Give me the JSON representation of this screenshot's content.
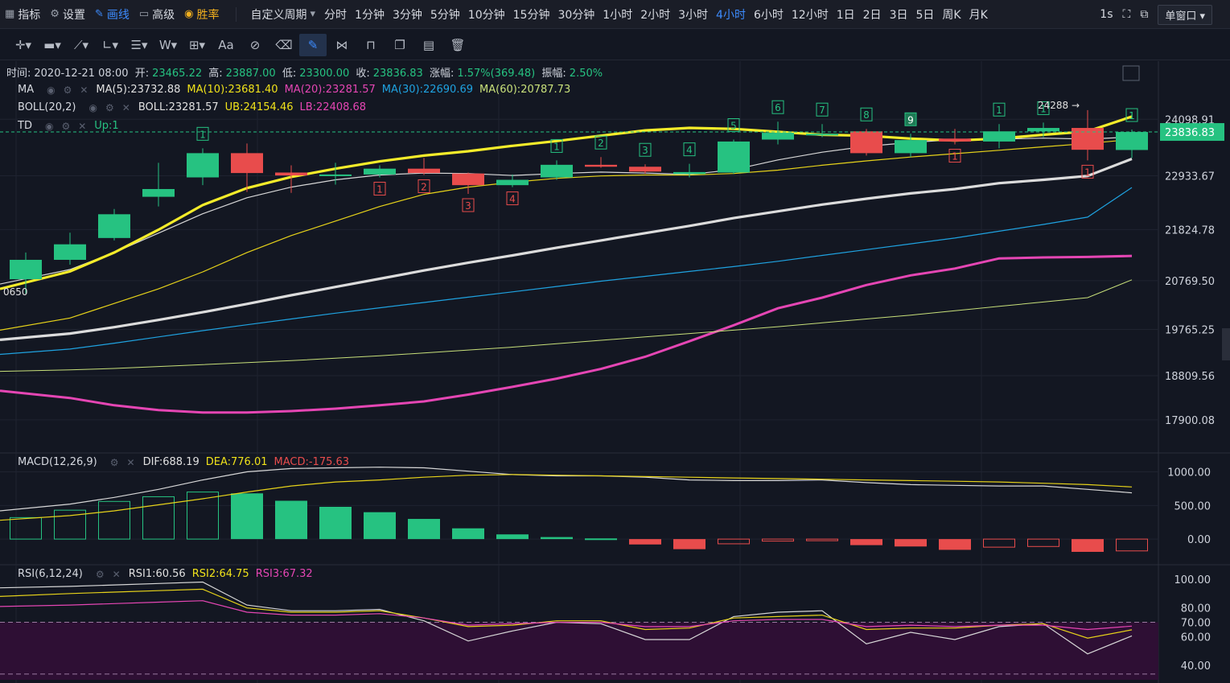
{
  "topbar": {
    "indicators_label": "指标",
    "settings_label": "设置",
    "draw_label": "画线",
    "advanced_label": "高级",
    "winrate_label": "胜率",
    "custom_period_label": "自定义周期",
    "periods": [
      "分时",
      "1分钟",
      "3分钟",
      "5分钟",
      "10分钟",
      "15分钟",
      "30分钟",
      "1小时",
      "2小时",
      "3小时",
      "4小时",
      "6小时",
      "12小时",
      "1日",
      "2日",
      "3日",
      "5日",
      "周K",
      "月K"
    ],
    "active_period": "4小时",
    "refresh_label": "1s",
    "window_select": "单窗口"
  },
  "ohlc_bar": {
    "time_label": "时间:",
    "time": "2020-12-21 08:00",
    "open_label": "开:",
    "open": "23465.22",
    "high_label": "高:",
    "high": "23887.00",
    "low_label": "低:",
    "low": "23300.00",
    "close_label": "收:",
    "close": "23836.83",
    "change_label": "涨幅:",
    "change": "1.57%(369.48)",
    "amplitude_label": "振幅:",
    "amplitude": "2.50%"
  },
  "legend": {
    "ma": {
      "name": "MA",
      "ma5": "MA(5):23732.88",
      "ma10": "MA(10):23681.40",
      "ma20": "MA(20):23281.57",
      "ma30": "MA(30):22690.69",
      "ma60": "MA(60):20787.73"
    },
    "boll": {
      "name": "BOLL(20,2)",
      "boll": "BOLL:23281.57",
      "ub": "UB:24154.46",
      "lb": "LB:22408.68"
    },
    "td": {
      "name": "TD",
      "up": "Up:1"
    },
    "macd": {
      "name": "MACD(12,26,9)",
      "dif": "DIF:688.19",
      "dea": "DEA:776.01",
      "macd": "MACD:-175.63"
    },
    "rsi": {
      "name": "RSI(6,12,24)",
      "rsi1": "RSI1:60.56",
      "rsi2": "RSI2:64.75",
      "rsi3": "RSI3:67.32"
    }
  },
  "colors": {
    "up": "#26c281",
    "down": "#e84c4c",
    "ma5": "#e0e0e0",
    "ma10": "#f0e21a",
    "ma20": "#e546b4",
    "ma30": "#1fa2e0",
    "ma60": "#c8e07a",
    "grid": "#1f2330",
    "bg": "#131722"
  },
  "price_marks": {
    "max_label": "24288",
    "min_label": "0650"
  },
  "chart_data": [
    {
      "type": "candlestick",
      "title": "",
      "ylim": [
        17400,
        24800
      ],
      "y_ticks": [
        "24098.91",
        "22933.67",
        "21824.78",
        "20769.50",
        "19765.25",
        "18809.56",
        "17900.08"
      ],
      "last_price": "23836.83",
      "candles": [
        {
          "o": 20800,
          "h": 21350,
          "l": 20500,
          "c": 21200
        },
        {
          "o": 21200,
          "h": 21760,
          "l": 21100,
          "c": 21520
        },
        {
          "o": 21650,
          "h": 22250,
          "l": 21600,
          "c": 22140
        },
        {
          "o": 22500,
          "h": 23200,
          "l": 22300,
          "c": 22660
        },
        {
          "o": 22900,
          "h": 23500,
          "l": 22740,
          "c": 23400
        },
        {
          "o": 23400,
          "h": 23600,
          "l": 22600,
          "c": 22990
        },
        {
          "o": 23000,
          "h": 23150,
          "l": 22580,
          "c": 22940
        },
        {
          "o": 22930,
          "h": 23200,
          "l": 22750,
          "c": 22960
        },
        {
          "o": 22960,
          "h": 23150,
          "l": 22900,
          "c": 23080
        },
        {
          "o": 23080,
          "h": 23300,
          "l": 22950,
          "c": 22990
        },
        {
          "o": 22980,
          "h": 23000,
          "l": 22560,
          "c": 22740
        },
        {
          "o": 22740,
          "h": 22960,
          "l": 22700,
          "c": 22850
        },
        {
          "o": 22900,
          "h": 23250,
          "l": 22850,
          "c": 23160
        },
        {
          "o": 23160,
          "h": 23320,
          "l": 23100,
          "c": 23120
        },
        {
          "o": 23120,
          "h": 23170,
          "l": 22980,
          "c": 23020
        },
        {
          "o": 22970,
          "h": 23180,
          "l": 22900,
          "c": 23010
        },
        {
          "o": 23000,
          "h": 23680,
          "l": 22970,
          "c": 23640
        },
        {
          "o": 23680,
          "h": 24050,
          "l": 23580,
          "c": 23820
        },
        {
          "o": 23770,
          "h": 24000,
          "l": 23730,
          "c": 23800
        },
        {
          "o": 23850,
          "h": 23900,
          "l": 23350,
          "c": 23400
        },
        {
          "o": 23400,
          "h": 23800,
          "l": 23320,
          "c": 23670
        },
        {
          "o": 23700,
          "h": 23900,
          "l": 23580,
          "c": 23640
        },
        {
          "o": 23640,
          "h": 24000,
          "l": 23500,
          "c": 23850
        },
        {
          "o": 23850,
          "h": 24030,
          "l": 23730,
          "c": 23920
        },
        {
          "o": 23920,
          "h": 24288,
          "l": 23250,
          "c": 23470
        },
        {
          "o": 23465.22,
          "h": 23887,
          "l": 23300,
          "c": 23836.83
        }
      ],
      "td_up": [
        null,
        null,
        null,
        null,
        "1",
        null,
        null,
        null,
        null,
        null,
        null,
        null,
        "1",
        "2",
        "3",
        "4",
        "5",
        "6",
        "7",
        "8",
        "9",
        null,
        "1",
        "1",
        null,
        "1"
      ],
      "td_down": [
        null,
        null,
        null,
        null,
        null,
        null,
        null,
        null,
        "1",
        "2",
        "3",
        "4",
        null,
        null,
        null,
        null,
        null,
        null,
        null,
        null,
        null,
        "1",
        null,
        null,
        "1",
        null
      ],
      "series": [
        {
          "name": "MA(5)",
          "values": [
            20700,
            21000,
            21350,
            21750,
            22150,
            22480,
            22700,
            22850,
            22950,
            22990,
            22980,
            22940,
            22980,
            23010,
            22990,
            22960,
            23060,
            23260,
            23420,
            23540,
            23620,
            23680,
            23690,
            23710,
            23690,
            23732.88
          ]
        },
        {
          "name": "MA(10)",
          "values": [
            19750,
            20000,
            20300,
            20600,
            20950,
            21350,
            21700,
            22000,
            22300,
            22550,
            22700,
            22800,
            22880,
            22930,
            22950,
            22950,
            22980,
            23050,
            23150,
            23240,
            23320,
            23390,
            23460,
            23530,
            23600,
            23681.4
          ]
        },
        {
          "name": "MA(20)",
          "values": [
            18500,
            18350,
            18200,
            18100,
            18050,
            18050,
            18080,
            18130,
            18200,
            18280,
            18420,
            18580,
            18750,
            18950,
            19200,
            19520,
            19850,
            20200,
            20420,
            20680,
            20880,
            21020,
            21230,
            21250,
            21260,
            21281.57
          ]
        },
        {
          "name": "MA(30)",
          "values": [
            19250,
            19360,
            19480,
            19610,
            19740,
            19860,
            19980,
            20100,
            20210,
            20320,
            20430,
            20540,
            20650,
            20760,
            20860,
            20960,
            21060,
            21170,
            21290,
            21410,
            21530,
            21650,
            21790,
            21930,
            22080,
            22690.69
          ]
        },
        {
          "name": "MA(60)",
          "values": [
            18900,
            18930,
            18960,
            19000,
            19040,
            19080,
            19120,
            19170,
            19220,
            19280,
            19340,
            19400,
            19470,
            19540,
            19610,
            19680,
            19750,
            19820,
            19900,
            19980,
            20060,
            20150,
            20240,
            20330,
            20420,
            20787.73
          ]
        },
        {
          "name": "UB",
          "values": [
            20600,
            20960,
            21350,
            21820,
            22330,
            22680,
            22910,
            23080,
            23230,
            23350,
            23440,
            23550,
            23650,
            23760,
            23870,
            23920,
            23900,
            23840,
            23780,
            23760,
            23700,
            23660,
            23700,
            23780,
            23850,
            24154.46
          ]
        },
        {
          "name": "BOLL",
          "values": [
            19550,
            19680,
            19810,
            19960,
            20120,
            20290,
            20470,
            20640,
            20810,
            20980,
            21140,
            21290,
            21450,
            21600,
            21750,
            21900,
            22060,
            22200,
            22340,
            22460,
            22570,
            22660,
            22780,
            22850,
            22930,
            23281.57
          ]
        }
      ]
    },
    {
      "type": "bar",
      "title": "MACD(12,26,9)",
      "y_ticks": [
        "1000.00",
        "500.00",
        "0.00"
      ],
      "ylim": [
        -250,
        1150
      ],
      "macd_hist": [
        320,
        430,
        560,
        630,
        700,
        680,
        570,
        480,
        400,
        300,
        160,
        70,
        30,
        10,
        -80,
        -150,
        -70,
        -30,
        -20,
        -90,
        -110,
        -160,
        -120,
        -110,
        -190,
        -175.63
      ],
      "dif": [
        420,
        520,
        620,
        740,
        880,
        1000,
        1050,
        1060,
        1070,
        1060,
        1010,
        960,
        940,
        940,
        920,
        880,
        870,
        870,
        880,
        840,
        810,
        800,
        790,
        790,
        740,
        688.19
      ],
      "dea": [
        280,
        350,
        420,
        510,
        600,
        700,
        790,
        850,
        880,
        920,
        950,
        960,
        950,
        940,
        930,
        920,
        910,
        900,
        890,
        880,
        870,
        860,
        850,
        830,
        810,
        776.01
      ]
    },
    {
      "type": "line",
      "title": "RSI(6,12,24)",
      "y_ticks": [
        "100.00",
        "80.00",
        "70.00",
        "60.00",
        "40.00"
      ],
      "ylim": [
        30,
        105
      ],
      "rsi1": [
        94,
        95,
        96,
        97,
        98,
        82,
        78,
        78,
        79,
        71,
        57,
        64,
        70,
        69,
        58,
        58,
        74,
        77,
        78,
        55,
        63,
        58,
        67,
        69,
        48,
        60.56
      ],
      "rsi2": [
        88,
        90,
        91,
        92,
        93,
        80,
        77,
        77,
        78,
        73,
        67,
        68,
        71,
        71,
        65,
        66,
        73,
        74,
        75,
        65,
        66,
        66,
        68,
        69,
        59,
        64.75
      ],
      "rsi3": [
        81,
        82,
        83,
        84,
        85,
        77,
        75,
        75,
        76,
        73,
        68,
        69,
        70,
        70,
        67,
        67,
        71,
        72,
        72,
        67,
        68,
        67,
        68,
        68,
        65,
        67.32
      ]
    }
  ]
}
